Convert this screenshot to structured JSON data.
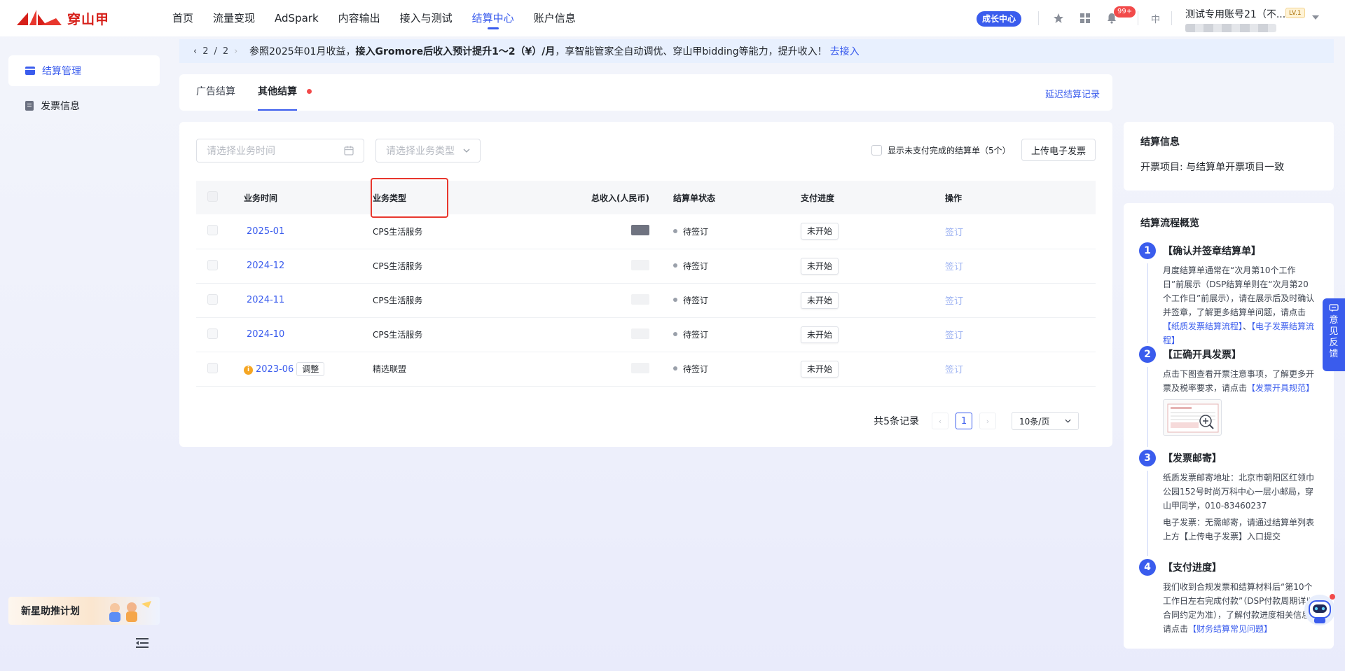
{
  "header": {
    "logo_text": "穿山甲",
    "nav": [
      "首页",
      "流量变现",
      "AdSpark",
      "内容输出",
      "接入与测试",
      "结算中心",
      "账户信息"
    ],
    "active_nav": 5,
    "growth_badge": "成长中心",
    "notification_count": "99+",
    "language": "中",
    "account_name": "测试专用账号21（不...",
    "level": "LV.1"
  },
  "sidebar": {
    "items": [
      {
        "label": "结算管理",
        "icon": "card-icon"
      },
      {
        "label": "发票信息",
        "icon": "document-icon"
      }
    ],
    "promo": "新星助推计划"
  },
  "notice": {
    "page_current": "2",
    "page_sep": "/",
    "page_total": "2",
    "text_before": "参照2025年01月收益，",
    "text_bold": "接入Gromore后收入预计提升1～2（¥）/月",
    "text_after": "，享智能管家全自动调优、穿山甲bidding等能力，提升收入！",
    "link": "去接入"
  },
  "tabs": {
    "items": [
      "广告结算",
      "其他结算"
    ],
    "active": 1,
    "right_link": "延迟结算记录"
  },
  "filters": {
    "time_placeholder": "请选择业务时间",
    "type_placeholder": "请选择业务类型",
    "show_unpaid": "显示未支付完成的结算单（5个）",
    "upload_button": "上传电子发票"
  },
  "table": {
    "columns": [
      "业务时间",
      "业务类型",
      "总收入(人民币)",
      "结算单状态",
      "支付进度",
      "操作"
    ],
    "rows": [
      {
        "month": "2025-01",
        "type": "CPS生活服务",
        "status": "待签订",
        "progress": "未开始",
        "action": "签订"
      },
      {
        "month": "2024-12",
        "type": "CPS生活服务",
        "status": "待签订",
        "progress": "未开始",
        "action": "签订"
      },
      {
        "month": "2024-11",
        "type": "CPS生活服务",
        "status": "待签订",
        "progress": "未开始",
        "action": "签订"
      },
      {
        "month": "2024-10",
        "type": "CPS生活服务",
        "status": "待签订",
        "progress": "未开始",
        "action": "签订"
      },
      {
        "month": "2023-06",
        "type": "精选联盟",
        "status": "待签订",
        "progress": "未开始",
        "action": "签订",
        "tag": "调整",
        "info_icon": "i"
      }
    ]
  },
  "pagination": {
    "total_text": "共5条记录",
    "current_page": "1",
    "page_size": "10条/页"
  },
  "settlement_info": {
    "title": "结算信息",
    "line": "开票项目: 与结算单开票项目一致"
  },
  "flow": {
    "title": "结算流程概览",
    "steps": [
      {
        "num": "1",
        "title": "【确认并签章结算单】",
        "body": "月度结算单通常在“次月第10个工作日”前展示（DSP结算单则在“次月第20个工作日”前展示），请在展示后及时确认并签章，了解更多结算单问题，请点击",
        "link1": "【纸质发票结算流程】",
        "sep": "、",
        "link2": "【电子发票结算流程】"
      },
      {
        "num": "2",
        "title": "【正确开具发票】",
        "body": "点击下图查看开票注意事项，了解更多开票及税率要求，请点击",
        "link1": "【发票开具规范】"
      },
      {
        "num": "3",
        "title": "【发票邮寄】",
        "body": "纸质发票邮寄地址：北京市朝阳区红领巾公园152号时尚万科中心一层小邮局，穿山甲同学，010-83460237",
        "body2": "电子发票：无需邮寄，请通过结算单列表上方【上传电子发票】入口提交"
      },
      {
        "num": "4",
        "title": "【支付进度】",
        "body": "我们收到合规发票和结算材料后“第10个工作日左右完成付款”（DSP付款周期详以合同约定为准），了解付款进度相关信息,请点击",
        "link1": "【财务结算常见问题】"
      }
    ]
  },
  "feedback": [
    "意",
    "见",
    "反",
    "馈"
  ],
  "colors": {
    "accent": "#3a5ced",
    "brand_red": "#d6201a",
    "highlight": "#e8372e"
  }
}
